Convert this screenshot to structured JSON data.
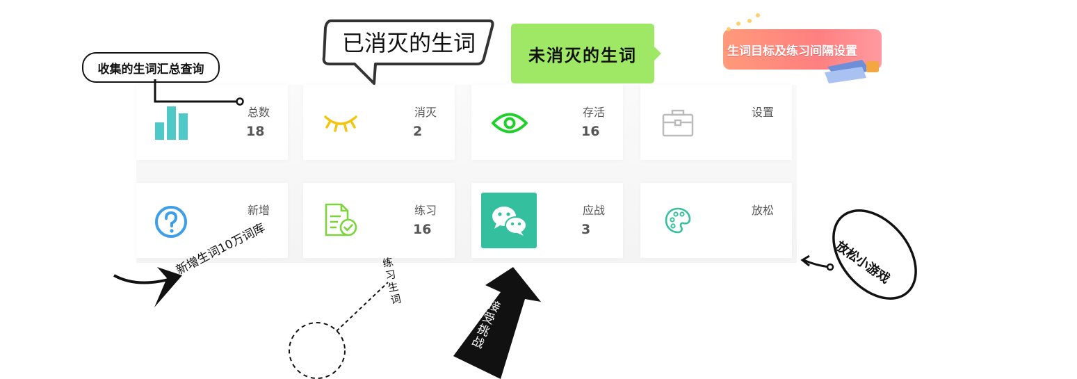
{
  "annotations": {
    "collected_query": "收集的生词汇总查询",
    "eliminated_words": "已消灭的生词",
    "uneliminated_words": "未消灭的生词",
    "goal_settings": "生词目标及练习间隔设置",
    "add_words": "新增生词10万词库",
    "practice_words": "练习生词",
    "accept_challenge": "接受挑战",
    "relax_game": "放松小游戏"
  },
  "cards": [
    {
      "id": "total",
      "label": "总数",
      "value": "18",
      "icon": "bar-chart-icon"
    },
    {
      "id": "eliminated",
      "label": "消灭",
      "value": "2",
      "icon": "closed-eye-icon"
    },
    {
      "id": "alive",
      "label": "存活",
      "value": "16",
      "icon": "eye-icon"
    },
    {
      "id": "settings",
      "label": "设置",
      "value": "",
      "icon": "briefcase-icon"
    },
    {
      "id": "add",
      "label": "新增",
      "value": "",
      "icon": "question-icon"
    },
    {
      "id": "practice",
      "label": "练习",
      "value": "16",
      "icon": "checklist-doc-icon"
    },
    {
      "id": "battle",
      "label": "应战",
      "value": "3",
      "icon": "wechat-icon"
    },
    {
      "id": "relax",
      "label": "放松",
      "value": "",
      "icon": "palette-icon"
    }
  ],
  "colors": {
    "teal": "#4ec9c7",
    "yellow": "#f3c510",
    "green": "#1ed02a",
    "gray": "#bbbbbb",
    "blue": "#3d9fe8",
    "lime": "#7ad43a",
    "wechat_bg": "#34bf9e",
    "tag_green": "#9ee865",
    "banner_orange": "#ff8a7c"
  }
}
